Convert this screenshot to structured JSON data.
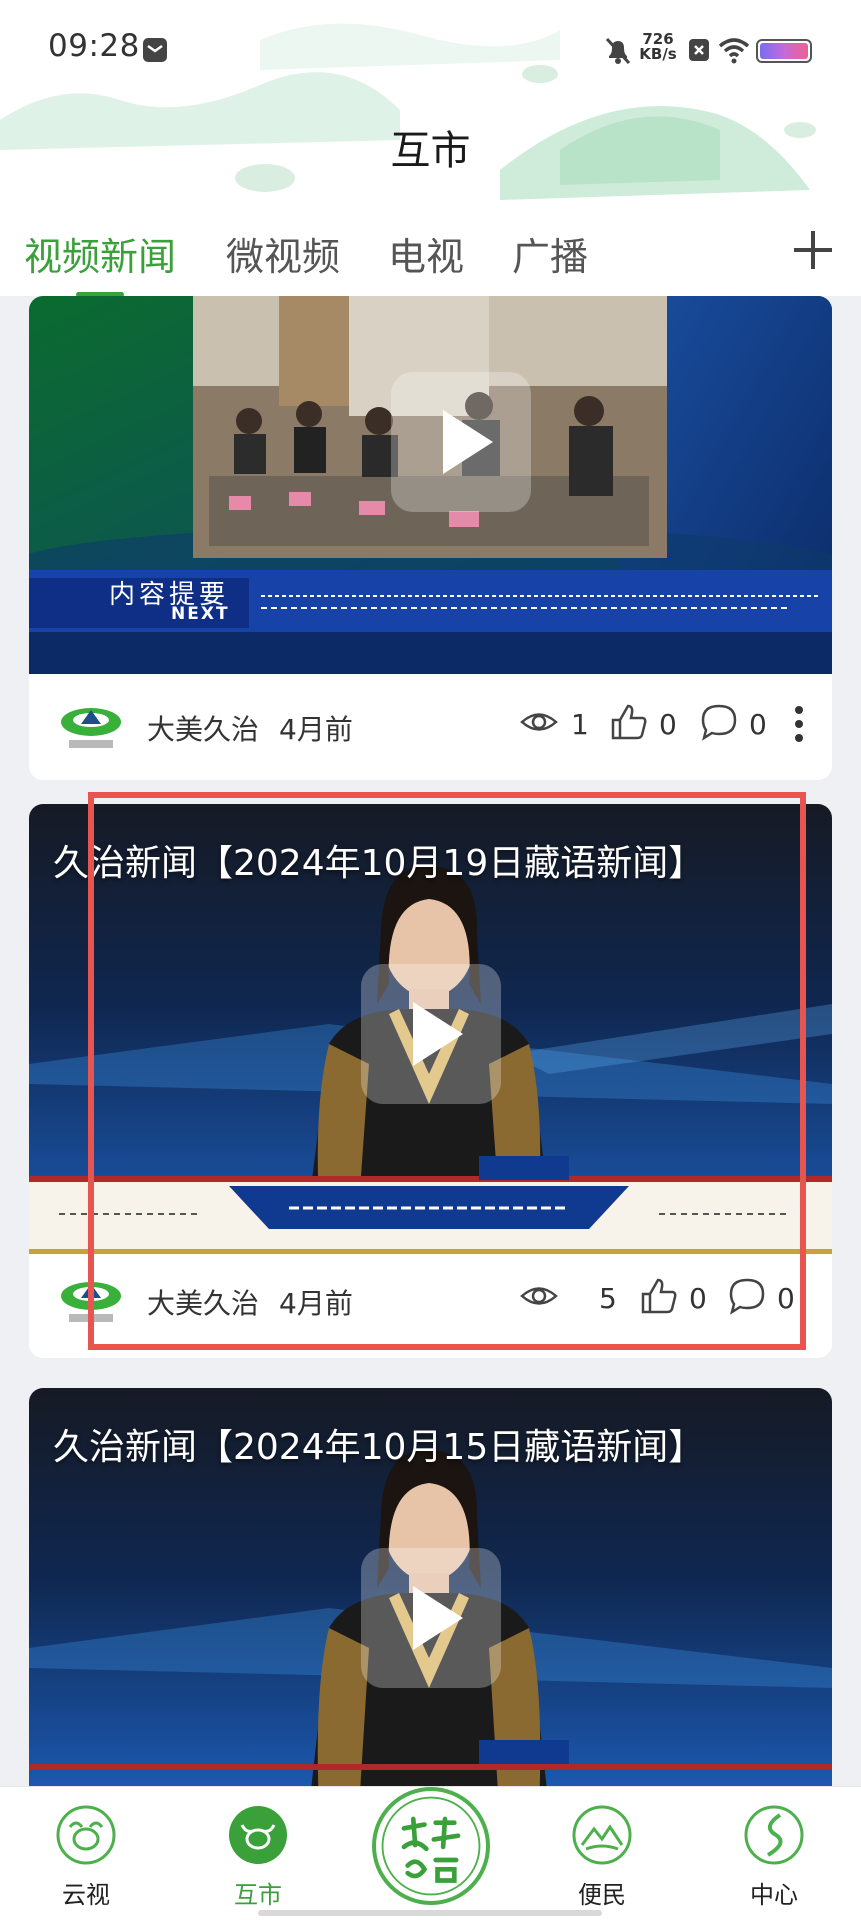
{
  "status_bar": {
    "time": "09:28",
    "net_speed_value": "726",
    "net_speed_unit": "KB/s",
    "icons": [
      "notification-icon",
      "mute-bell-icon",
      "sim-x-icon",
      "wifi-icon",
      "battery-icon"
    ]
  },
  "header": {
    "title": "互市"
  },
  "tabs": [
    {
      "label": "视频新闻",
      "active": true
    },
    {
      "label": "微视频",
      "active": false
    },
    {
      "label": "电视",
      "active": false
    },
    {
      "label": "广播",
      "active": false
    }
  ],
  "tab_add_icon": "plus-icon",
  "cards": [
    {
      "title": "",
      "thumb_caption": "内容提要",
      "thumb_sub": "NEXT",
      "author": "大美久治",
      "ago": "4月前",
      "views": "1",
      "likes": "0",
      "comments": "0"
    },
    {
      "title": "久治新闻【2024年10月19日藏语新闻】",
      "author": "大美久治",
      "ago": "4月前",
      "views": "5",
      "likes": "0",
      "comments": "0"
    },
    {
      "title": "久治新闻【2024年10月15日藏语新闻】"
    }
  ],
  "bottom_nav": [
    {
      "label": "云视",
      "icon": "yak-icon",
      "active": false
    },
    {
      "label": "互市",
      "icon": "bull-icon",
      "active": true
    },
    {
      "label": "天赐久治",
      "icon": "center-logo",
      "active": false
    },
    {
      "label": "便民",
      "icon": "landscape-icon",
      "active": false
    },
    {
      "label": "中心",
      "icon": "road-icon",
      "active": false
    }
  ],
  "colors": {
    "accent": "#3aa03a",
    "highlight": "#e85450",
    "background": "#eef0f3"
  }
}
